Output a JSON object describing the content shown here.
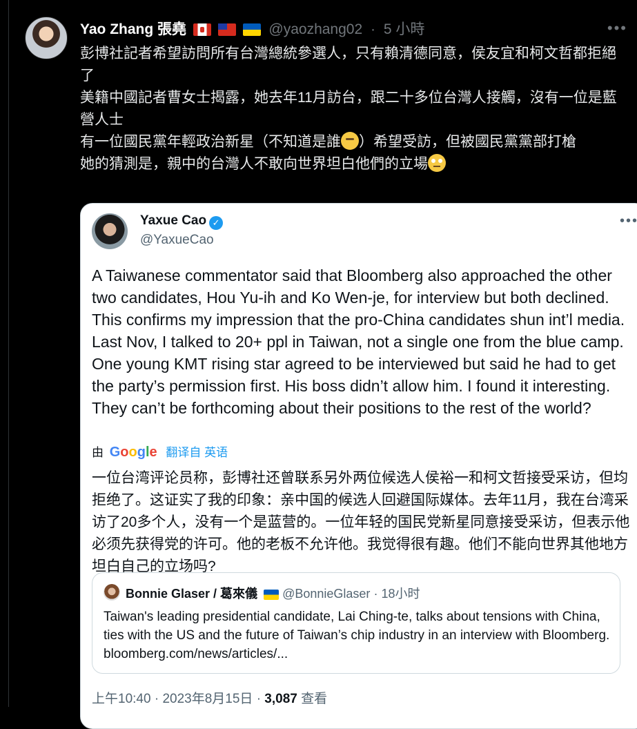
{
  "outer_post": {
    "author_name": "Yao Zhang 張堯",
    "handle": "@yaozhang02",
    "time": "5 小時",
    "lines": [
      "彭博社記者希望訪問所有台灣總統參選人，只有賴清德同意，侯友宜和柯文哲都拒絕了",
      "美籍中國記者曹女士揭露，她去年11月訪台，跟二十多位台灣人接觸，沒有一位是藍營人士",
      "有一位國民黨年輕政治新星（不知道是誰",
      "）希望受訪，但被國民黨黨部打槍",
      "她的猜測是，親中的台灣人不敢向世界坦白他們的立場"
    ]
  },
  "embedded_post": {
    "author_name": "Yaxue Cao",
    "handle": "@YaxueCao",
    "text": "A Taiwanese commentator said that Bloomberg also approached the other two candidates, Hou Yu-ih and Ko Wen-je, for interview but both declined. This confirms my impression that the pro-China  candidates shun int’l media. Last Nov, I talked to 20+ ppl in Taiwan, not a single one from the blue camp. One young KMT rising star agreed to be interviewed but said he had to get the party’s permission first. His boss didn’t allow him. I found it interesting. They can’t be forthcoming about their positions to the rest of the world?",
    "translation_prefix": "由",
    "translation_provider": "Google",
    "translation_link": "翻译自 英语",
    "translated_text": "一位台湾评论员称，彭博社还曾联系另外两位候选人侯裕一和柯文哲接受采访，但均拒绝了。这证实了我的印象：亲中国的候选人回避国际媒体。去年11月，我在台湾采访了20多个人，没有一个是蓝营的。一位年轻的国民党新星同意接受采访，但表示他必须先获得党的许可。他的老板不允许他。我觉得很有趣。他们不能向世界其他地方坦白自己的立场吗?",
    "quoted": {
      "author_name": "Bonnie Glaser / 葛來儀",
      "handle": "@BonnieGlaser",
      "time": "18小时",
      "text": "Taiwan's leading presidential candidate, Lai Ching-te, talks about tensions with China, ties with the US and the future of Taiwan’s chip industry in an interview with Bloomberg. bloomberg.com/news/articles/..."
    },
    "footer": {
      "time": "上午10:40",
      "date": "2023年8月15日",
      "views_count": "3,087",
      "views_label": "查看"
    }
  },
  "icons": [
    "more-icon",
    "verified-icon",
    "google-logo",
    "thinking-face-emoji",
    "eye-roll-emoji"
  ],
  "colors": {
    "background": "#000000",
    "card": "#ffffff",
    "accent": "#1d9bf0",
    "muted": "#71767b"
  }
}
